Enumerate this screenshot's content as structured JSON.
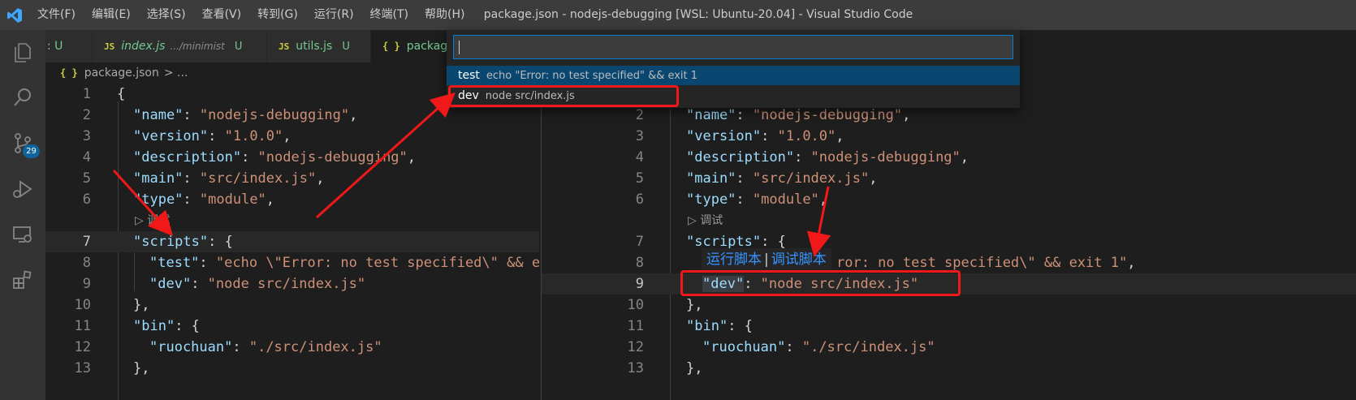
{
  "title_bar": {
    "menus": [
      "文件(F)",
      "编辑(E)",
      "选择(S)",
      "查看(V)",
      "转到(G)",
      "运行(R)",
      "终端(T)",
      "帮助(H)"
    ],
    "window_title": "package.json - nodejs-debugging [WSL: Ubuntu-20.04] - Visual Studio Code"
  },
  "activity_bar": {
    "icons": [
      "explorer-icon",
      "search-icon",
      "source-control-icon",
      "run-debug-icon",
      "remote-explorer-icon",
      "extensions-icon"
    ],
    "scm_badge": "29"
  },
  "left_editor": {
    "tabs": [
      {
        "prefix": "",
        "name": ": U",
        "path": "",
        "mod": ""
      },
      {
        "prefix": "JS",
        "name": "index.js",
        "path": ".../minimist",
        "mod": "U"
      },
      {
        "prefix": "JS",
        "name": "utils.js",
        "path": "",
        "mod": "U"
      },
      {
        "prefix": "{ }",
        "name": "package",
        "path": "",
        "mod": ""
      }
    ],
    "breadcrumb": {
      "icon": "{ }",
      "file": "package.json",
      "rest": "> ..."
    },
    "codelens": "调试"
  },
  "right_editor": {
    "codelens": "调试",
    "hover": {
      "run": "运行脚本",
      "sep": "|",
      "debug": "调试脚本"
    }
  },
  "code": {
    "l1": "{",
    "name_k": "\"name\"",
    "name_v": "\"nodejs-debugging\"",
    "version_k": "\"version\"",
    "version_v": "\"1.0.0\"",
    "desc_k": "\"description\"",
    "desc_v": "\"nodejs-debugging\"",
    "main_k": "\"main\"",
    "main_v": "\"src/index.js\"",
    "type_k": "\"type\"",
    "type_v": "\"module\"",
    "scripts_k": "\"scripts\"",
    "test_k": "\"test\"",
    "test_v_left": "\"echo \\\"Error: no test specified\\\" && e",
    "test_v_right_tail": "ror: no test specified\\\" && exit 1\"",
    "dev_k": "\"dev\"",
    "dev_v": "\"node src/index.js\"",
    "close_obj": "},",
    "bin_k": "\"bin\"",
    "ruo_k": "\"ruochuan\"",
    "ruo_v": "\"./src/index.js\"",
    "line_numbers_left": [
      "1",
      "2",
      "3",
      "4",
      "5",
      "6",
      "7",
      "8",
      "9",
      "10",
      "11",
      "12",
      "13"
    ],
    "line_numbers_right": [
      "2",
      "3",
      "4",
      "5",
      "6",
      "7",
      "8",
      "9",
      "10",
      "11",
      "12",
      "13"
    ]
  },
  "quick_pick": {
    "items": [
      {
        "label": "test",
        "desc": "echo \"Error: no test specified\" && exit 1"
      },
      {
        "label": "dev",
        "desc": "node src/index.js"
      }
    ]
  },
  "colors": {
    "accent": "#007fd4",
    "selection": "#094771",
    "annotation": "#f01818"
  }
}
